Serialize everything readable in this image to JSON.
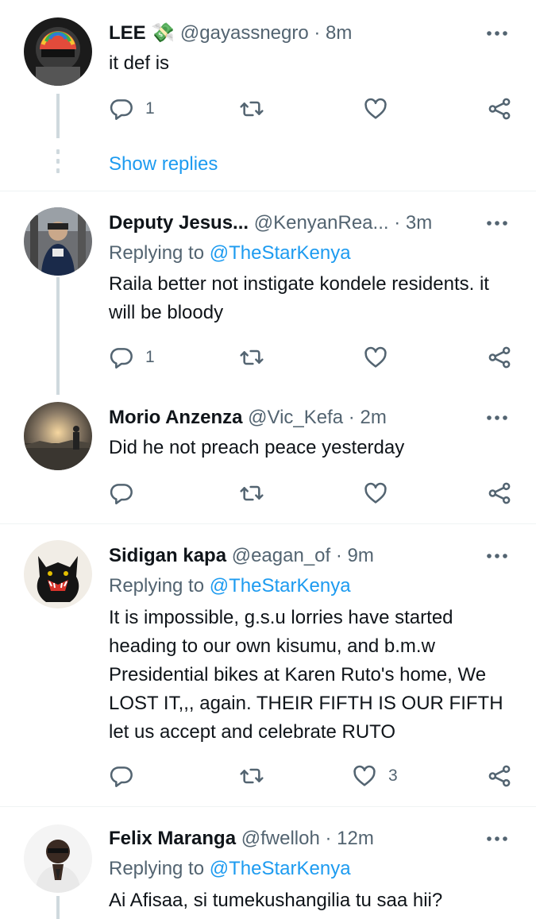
{
  "colors": {
    "accent": "#1d9bf0",
    "secondary_text": "#536471",
    "primary_text": "#0f1419",
    "divider": "#eff3f4"
  },
  "tweets": [
    {
      "name": "LEE 💸",
      "handle": "@gayassnegro",
      "sep": "·",
      "time": "8m",
      "reply_prefix": "",
      "reply_mention": "",
      "text": "it def is",
      "reply_count": "1",
      "retweet_count": "",
      "like_count": "",
      "show_replies": "Show replies"
    },
    {
      "name": "Deputy Jesus...",
      "handle": "@KenyanRea...",
      "sep": "·",
      "time": "3m",
      "reply_prefix": "Replying to",
      "reply_mention": "@TheStarKenya",
      "text": "Raila better not instigate  kondele residents. it  will be bloody",
      "reply_count": "1",
      "retweet_count": "",
      "like_count": ""
    },
    {
      "name": "Morio Anzenza",
      "handle": "@Vic_Kefa",
      "sep": "·",
      "time": "2m",
      "reply_prefix": "",
      "reply_mention": "",
      "text": "Did he not preach peace yesterday",
      "reply_count": "",
      "retweet_count": "",
      "like_count": ""
    },
    {
      "name": "Sidigan kapa",
      "handle": "@eagan_of",
      "sep": "·",
      "time": "9m",
      "reply_prefix": "Replying to",
      "reply_mention": "@TheStarKenya",
      "text": "It is impossible, g.s.u lorries have started heading to our own kisumu, and b.m.w Presidential bikes at Karen Ruto's home, We LOST IT,,, again. THEIR FIFTH IS OUR FIFTH let us accept and celebrate RUTO",
      "reply_count": "",
      "retweet_count": "",
      "like_count": "3"
    },
    {
      "name": "Felix Maranga",
      "handle": "@fwelloh",
      "sep": "·",
      "time": "12m",
      "reply_prefix": "Replying to",
      "reply_mention": "@TheStarKenya",
      "text": "Ai Afisaa, si tumekushangilia tu saa hii?"
    }
  ]
}
